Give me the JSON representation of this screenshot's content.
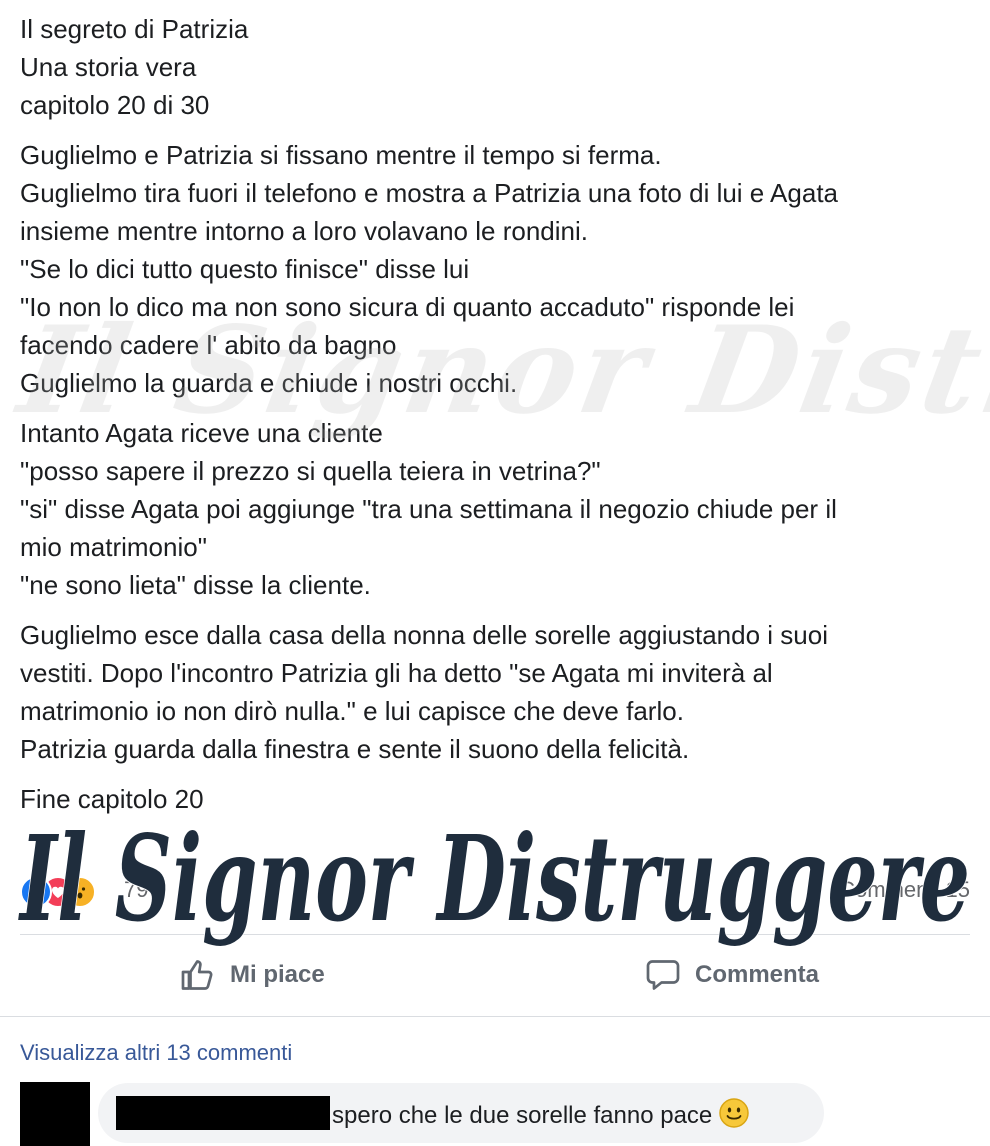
{
  "post": {
    "header_lines": [
      "Il segreto di Patrizia",
      "Una storia vera",
      "capitolo 20 di 30"
    ],
    "paragraph1": [
      "Guglielmo e Patrizia si fissano mentre il tempo si ferma.",
      "Guglielmo tira fuori il telefono e mostra a Patrizia una foto di lui e Agata",
      "insieme mentre intorno a loro volavano le rondini.",
      "\"Se lo dici tutto questo finisce\" disse lui",
      "\"Io non lo dico ma non sono sicura di quanto accaduto\" risponde lei",
      "facendo cadere l' abito da bagno",
      "Guglielmo la guarda e chiude i nostri occhi."
    ],
    "paragraph2": [
      "Intanto Agata riceve una cliente",
      "\"posso sapere il prezzo si quella teiera in vetrina?\"",
      "\"si\" disse Agata poi aggiunge \"tra una settimana il negozio chiude per il",
      "mio matrimonio\"",
      "\"ne sono lieta\" disse la cliente."
    ],
    "paragraph3": [
      "Guglielmo esce dalla casa della nonna delle sorelle aggiustando i suoi",
      "vestiti. Dopo l'incontro Patrizia gli ha detto \"se Agata mi inviterà al",
      "matrimonio io non dirò nulla.\" e lui capisce che deve farlo.",
      "Patrizia guarda dalla finestra e sente il suono della felicità."
    ],
    "ending": "Fine capitolo 20"
  },
  "watermark": {
    "text": "Il Signor Distruggere",
    "color": "#1f2d3d"
  },
  "reactions": {
    "icons": [
      "like-icon",
      "love-icon",
      "wow-icon"
    ],
    "count": "79",
    "comments_label": "Commenti 15"
  },
  "actions": {
    "like_label": "Mi piace",
    "comment_label": "Commenta"
  },
  "comments": {
    "more_label": "Visualizza altri 13 commenti",
    "first": {
      "text": "spero che le due sorelle fanno pace"
    }
  },
  "colors": {
    "link": "#385898",
    "like_blue": "#1877f2",
    "love_red": "#f33e58",
    "wow_yellow": "#f7b125",
    "bubble_bg": "#f2f3f5"
  }
}
